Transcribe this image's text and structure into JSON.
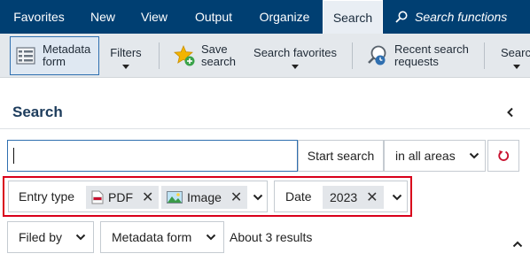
{
  "menubar": {
    "items": [
      "Favorites",
      "New",
      "View",
      "Output",
      "Organize",
      "Search"
    ],
    "active": "Search",
    "search_functions": "Search functions"
  },
  "ribbon": {
    "metadata_form": "Metadata form",
    "filters": "Filters",
    "save_search": "Save search",
    "search_favorites": "Search favorites",
    "recent_search_requests": "Recent search requests",
    "overflow": "Searc"
  },
  "panel": {
    "title": "Search"
  },
  "search": {
    "input_value": "",
    "start_button": "Start search",
    "scope": "in all areas"
  },
  "filters": {
    "entry_type_label": "Entry type",
    "entry_types": [
      "PDF",
      "Image"
    ],
    "date_label": "Date",
    "date_value": "2023"
  },
  "bottom": {
    "filed_by": "Filed by",
    "metadata_form": "Metadata form",
    "results": "About 3 results"
  },
  "colors": {
    "menubar_bg": "#003f72",
    "ribbon_bg": "#e4e8ec",
    "highlight": "#d9001b",
    "accent": "#2f6fb0"
  }
}
